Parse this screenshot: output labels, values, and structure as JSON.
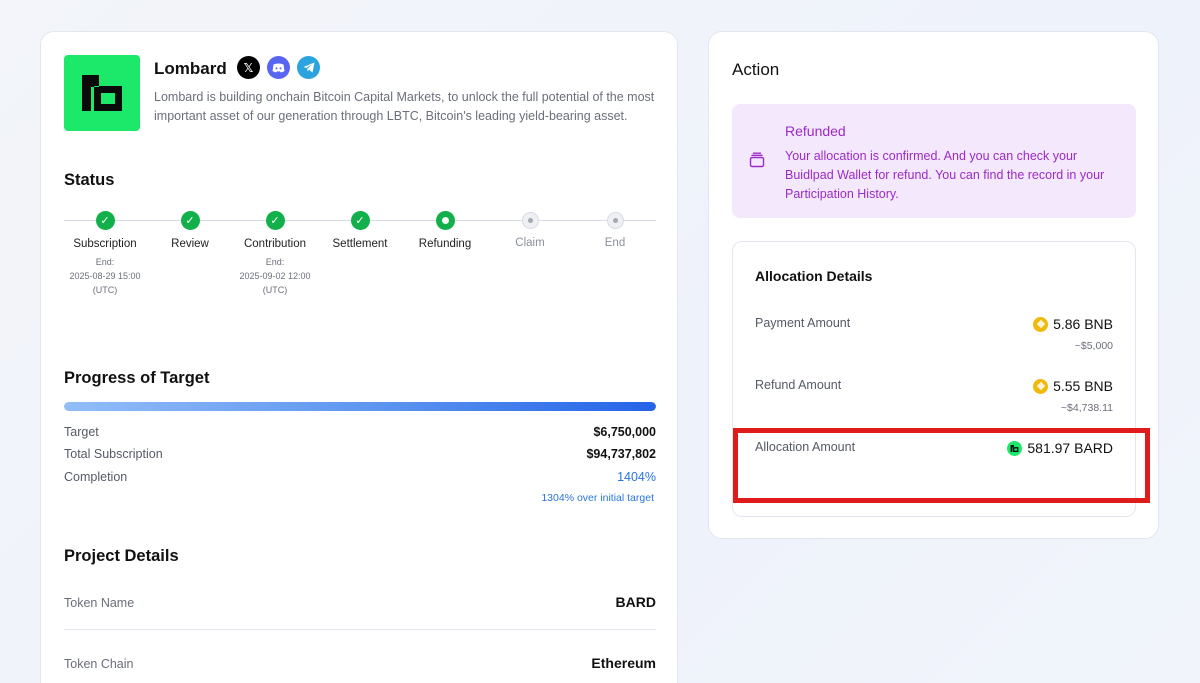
{
  "project": {
    "name": "Lombard",
    "description": "Lombard is building onchain Bitcoin Capital Markets, to unlock the full potential of the most important asset of our generation through LBTC, Bitcoin's leading yield-bearing asset.",
    "logo_color": "#1ce86a",
    "socials": [
      {
        "name": "x-icon",
        "glyph": "𝕏"
      },
      {
        "name": "discord-icon",
        "glyph": "◉"
      },
      {
        "name": "telegram-icon",
        "glyph": "➤"
      }
    ]
  },
  "status": {
    "title": "Status",
    "steps": [
      {
        "label": "Subscription",
        "state": "done",
        "end_label": "End:",
        "end_date": "2025-08-29 15:00",
        "end_tz": "(UTC)"
      },
      {
        "label": "Review",
        "state": "done"
      },
      {
        "label": "Contribution",
        "state": "done",
        "end_label": "End:",
        "end_date": "2025-09-02 12:00",
        "end_tz": "(UTC)"
      },
      {
        "label": "Settlement",
        "state": "done"
      },
      {
        "label": "Refunding",
        "state": "current"
      },
      {
        "label": "Claim",
        "state": "pending"
      },
      {
        "label": "End",
        "state": "pending"
      }
    ]
  },
  "progress": {
    "title": "Progress of Target",
    "fill_fraction": 1.0,
    "target_label": "Target",
    "target_value": "$6,750,000",
    "total_label": "Total Subscription",
    "total_value": "$94,737,802",
    "completion_label": "Completion",
    "completion_value": "1404%",
    "over_note": "1304% over initial target"
  },
  "details": {
    "title": "Project Details",
    "token_name_label": "Token Name",
    "token_name": "BARD",
    "token_chain_label": "Token Chain",
    "token_chain": "Ethereum"
  },
  "action": {
    "title": "Action",
    "refund_title": "Refunded",
    "refund_text": "Your allocation is confirmed. And you can check your Buidlpad Wallet for refund. You can find the record in your Participation History.",
    "allocation": {
      "title": "Allocation Details",
      "payment_label": "Payment Amount",
      "payment_amount": "5.86 BNB",
      "payment_usd": "~$5,000",
      "refund_label": "Refund Amount",
      "refund_amount": "5.55 BNB",
      "refund_usd": "~$4,738.11",
      "allocation_label": "Allocation Amount",
      "allocation_amount": "581.97 BARD"
    }
  },
  "colors": {
    "accent_green": "#12b04a",
    "accent_blue": "#2a74e0",
    "refund_purple": "#9b2bc6",
    "highlight_red": "#e01b1b"
  }
}
